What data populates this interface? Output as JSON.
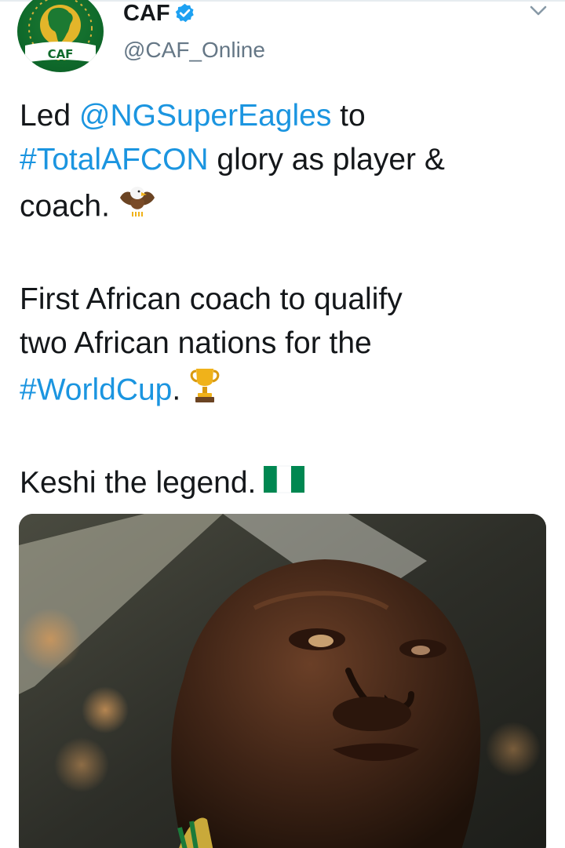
{
  "author": {
    "display_name": "CAF",
    "handle": "@CAF_Online",
    "avatar_text": "CAF",
    "verified": true
  },
  "tweet": {
    "line1_prefix": "Led ",
    "mention": "@NGSuperEagles",
    "line1_suffix": " to",
    "hashtag1": "#TotalAFCON",
    "line2_suffix": " glory as player &",
    "line3": "coach.",
    "paragraph2_line1": "First African coach to qualify",
    "paragraph2_line2": "two African nations for the",
    "hashtag2": "#WorldCup",
    "paragraph2_end": ".",
    "paragraph3": "Keshi the legend."
  },
  "icons": {
    "verified": "verified-badge-icon",
    "menu": "chevron-down-icon",
    "eagle": "eagle-emoji",
    "trophy": "trophy-emoji",
    "flag": "nigeria-flag-emoji"
  },
  "colors": {
    "link": "#1b95e0",
    "text": "#14171a",
    "secondary": "#657786",
    "avatar_green": "#0f6a2b",
    "avatar_gold": "#e8b923"
  }
}
